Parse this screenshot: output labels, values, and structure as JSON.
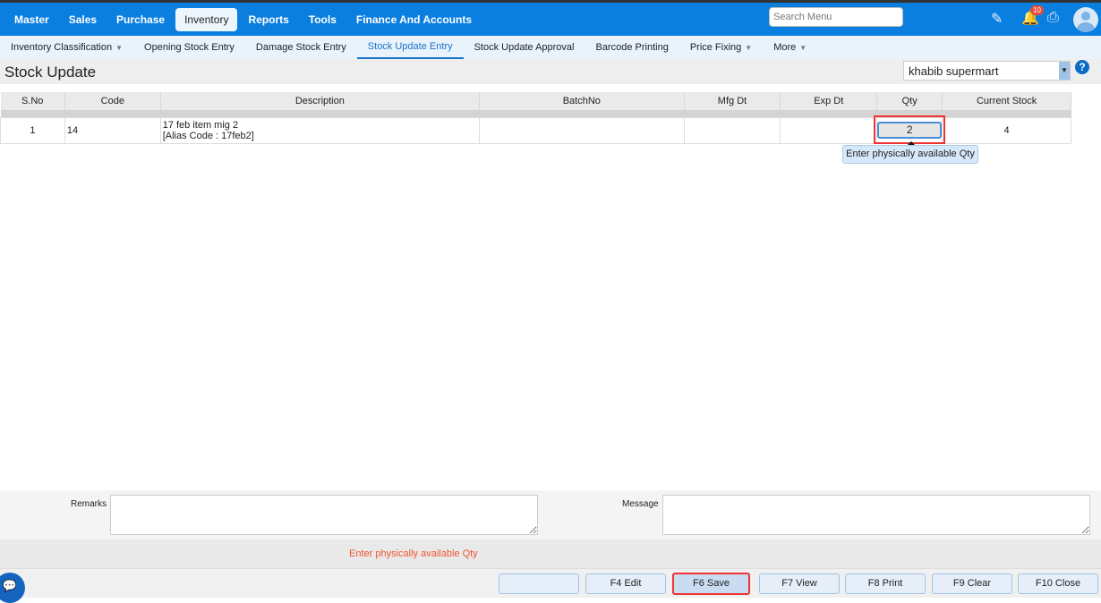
{
  "nav": {
    "items": [
      "Master",
      "Sales",
      "Purchase",
      "Inventory",
      "Reports",
      "Tools",
      "Finance And Accounts"
    ],
    "active": "Inventory",
    "search_placeholder": "Search Menu",
    "notification_count": "10"
  },
  "subnav": {
    "items": [
      {
        "label": "Inventory Classification",
        "dropdown": true
      },
      {
        "label": "Opening Stock Entry"
      },
      {
        "label": "Damage Stock Entry"
      },
      {
        "label": "Stock Update Entry",
        "active": true
      },
      {
        "label": "Stock Update Approval"
      },
      {
        "label": "Barcode Printing"
      },
      {
        "label": "Price Fixing",
        "dropdown": true
      },
      {
        "label": "More",
        "dropdown": true
      }
    ]
  },
  "page": {
    "title": "Stock Update",
    "branch": "khabib supermart",
    "help": "?"
  },
  "table": {
    "headers": [
      "S.No",
      "Code",
      "Description",
      "BatchNo",
      "Mfg Dt",
      "Exp Dt",
      "Qty",
      "Current Stock"
    ],
    "rows": [
      {
        "sno": "1",
        "code": "14",
        "description": "17 feb item mig 2",
        "alias": "[Alias Code : 17feb2]",
        "batch": "",
        "mfg": "",
        "exp": "",
        "qty": "2",
        "current_stock": "4"
      }
    ]
  },
  "tooltip": "Enter physically available Qty",
  "form": {
    "remarks_label": "Remarks",
    "message_label": "Message",
    "remarks": "",
    "message": ""
  },
  "error_message": "Enter physically available Qty",
  "buttons": [
    "",
    "F4 Edit",
    "F6 Save",
    "F7 View",
    "F8 Print",
    "F9 Clear",
    "F10 Close"
  ]
}
